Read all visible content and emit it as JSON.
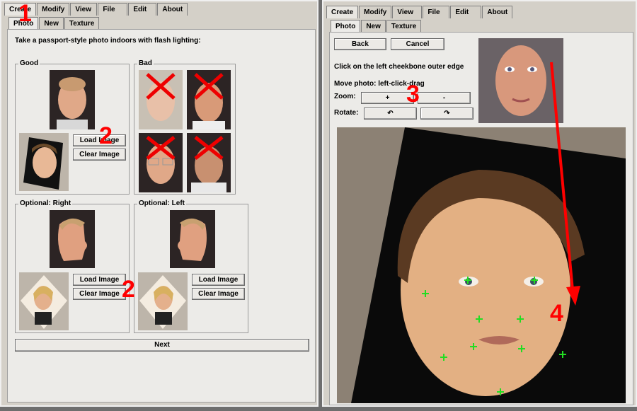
{
  "left": {
    "menu": [
      "Create",
      "Modify",
      "View",
      "File",
      "Edit",
      "About"
    ],
    "subtabs": [
      "Photo",
      "New",
      "Texture"
    ],
    "instruction": "Take a passport-style photo indoors with flash lighting:",
    "good_label": "Good",
    "bad_label": "Bad",
    "load_image": "Load Image",
    "clear_image": "Clear Image",
    "optional_right_label": "Optional: Right",
    "optional_left_label": "Optional: Left",
    "load_image_2": "Load Image",
    "clear_image_2": "Clear Image",
    "load_image_3": "Load Image",
    "clear_image_3": "Clear Image",
    "next": "Next"
  },
  "right": {
    "menu": [
      "Create",
      "Modify",
      "View",
      "File",
      "Edit",
      "About"
    ],
    "subtabs": [
      "Photo",
      "New",
      "Texture"
    ],
    "back": "Back",
    "cancel": "Cancel",
    "hint": "Click on the left cheekbone outer edge",
    "move": "Move photo: left-click-drag",
    "zoom_label": "Zoom:",
    "zoom_in": "+",
    "zoom_out": "-",
    "rotate_label": "Rotate:",
    "rotate_ccw": "↶",
    "rotate_cw": "↷"
  },
  "callouts": {
    "one": "1",
    "two_a": "2",
    "two_b": "2",
    "three": "3",
    "four": "4"
  },
  "colors": {
    "callout": "#ff0000",
    "marker": "#22dd22",
    "panel": "#d4d0c8"
  }
}
